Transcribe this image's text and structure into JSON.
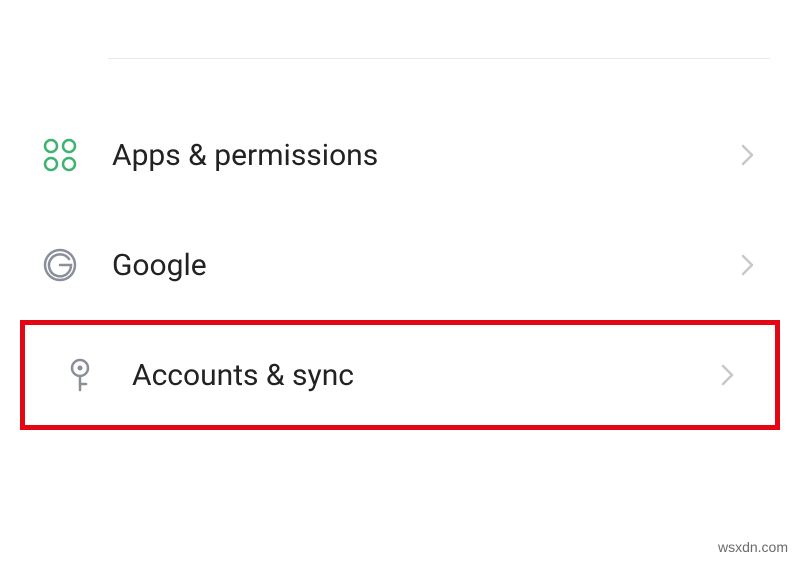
{
  "settings": {
    "items": [
      {
        "id": "apps-permissions",
        "label": "Apps & permissions",
        "highlighted": false
      },
      {
        "id": "google",
        "label": "Google",
        "highlighted": false
      },
      {
        "id": "accounts-sync",
        "label": "Accounts & sync",
        "highlighted": true
      }
    ]
  },
  "watermark": "wsxdn.com",
  "colors": {
    "highlight": "#e30613",
    "icon_green": "#3cb371",
    "icon_grey": "#8a8f9a",
    "chevron": "#c8c8c8",
    "text": "#222222"
  }
}
